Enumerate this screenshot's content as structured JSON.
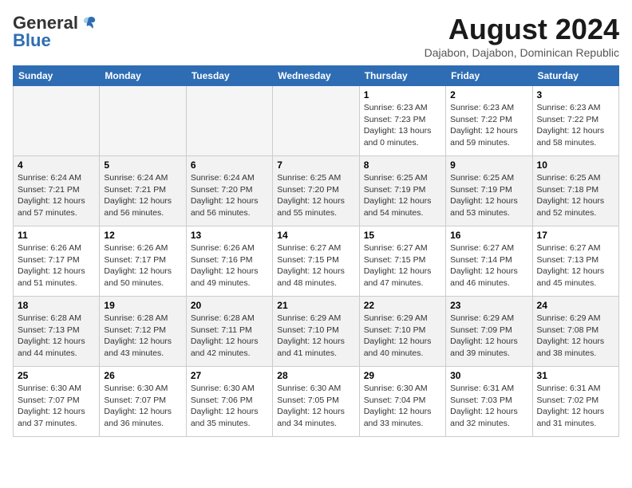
{
  "header": {
    "logo_general": "General",
    "logo_blue": "Blue",
    "month_title": "August 2024",
    "location": "Dajabon, Dajabon, Dominican Republic"
  },
  "calendar": {
    "days_of_week": [
      "Sunday",
      "Monday",
      "Tuesday",
      "Wednesday",
      "Thursday",
      "Friday",
      "Saturday"
    ],
    "weeks": [
      [
        {
          "day": "",
          "info": ""
        },
        {
          "day": "",
          "info": ""
        },
        {
          "day": "",
          "info": ""
        },
        {
          "day": "",
          "info": ""
        },
        {
          "day": "1",
          "info": "Sunrise: 6:23 AM\nSunset: 7:23 PM\nDaylight: 13 hours\nand 0 minutes."
        },
        {
          "day": "2",
          "info": "Sunrise: 6:23 AM\nSunset: 7:22 PM\nDaylight: 12 hours\nand 59 minutes."
        },
        {
          "day": "3",
          "info": "Sunrise: 6:23 AM\nSunset: 7:22 PM\nDaylight: 12 hours\nand 58 minutes."
        }
      ],
      [
        {
          "day": "4",
          "info": "Sunrise: 6:24 AM\nSunset: 7:21 PM\nDaylight: 12 hours\nand 57 minutes."
        },
        {
          "day": "5",
          "info": "Sunrise: 6:24 AM\nSunset: 7:21 PM\nDaylight: 12 hours\nand 56 minutes."
        },
        {
          "day": "6",
          "info": "Sunrise: 6:24 AM\nSunset: 7:20 PM\nDaylight: 12 hours\nand 56 minutes."
        },
        {
          "day": "7",
          "info": "Sunrise: 6:25 AM\nSunset: 7:20 PM\nDaylight: 12 hours\nand 55 minutes."
        },
        {
          "day": "8",
          "info": "Sunrise: 6:25 AM\nSunset: 7:19 PM\nDaylight: 12 hours\nand 54 minutes."
        },
        {
          "day": "9",
          "info": "Sunrise: 6:25 AM\nSunset: 7:19 PM\nDaylight: 12 hours\nand 53 minutes."
        },
        {
          "day": "10",
          "info": "Sunrise: 6:25 AM\nSunset: 7:18 PM\nDaylight: 12 hours\nand 52 minutes."
        }
      ],
      [
        {
          "day": "11",
          "info": "Sunrise: 6:26 AM\nSunset: 7:17 PM\nDaylight: 12 hours\nand 51 minutes."
        },
        {
          "day": "12",
          "info": "Sunrise: 6:26 AM\nSunset: 7:17 PM\nDaylight: 12 hours\nand 50 minutes."
        },
        {
          "day": "13",
          "info": "Sunrise: 6:26 AM\nSunset: 7:16 PM\nDaylight: 12 hours\nand 49 minutes."
        },
        {
          "day": "14",
          "info": "Sunrise: 6:27 AM\nSunset: 7:15 PM\nDaylight: 12 hours\nand 48 minutes."
        },
        {
          "day": "15",
          "info": "Sunrise: 6:27 AM\nSunset: 7:15 PM\nDaylight: 12 hours\nand 47 minutes."
        },
        {
          "day": "16",
          "info": "Sunrise: 6:27 AM\nSunset: 7:14 PM\nDaylight: 12 hours\nand 46 minutes."
        },
        {
          "day": "17",
          "info": "Sunrise: 6:27 AM\nSunset: 7:13 PM\nDaylight: 12 hours\nand 45 minutes."
        }
      ],
      [
        {
          "day": "18",
          "info": "Sunrise: 6:28 AM\nSunset: 7:13 PM\nDaylight: 12 hours\nand 44 minutes."
        },
        {
          "day": "19",
          "info": "Sunrise: 6:28 AM\nSunset: 7:12 PM\nDaylight: 12 hours\nand 43 minutes."
        },
        {
          "day": "20",
          "info": "Sunrise: 6:28 AM\nSunset: 7:11 PM\nDaylight: 12 hours\nand 42 minutes."
        },
        {
          "day": "21",
          "info": "Sunrise: 6:29 AM\nSunset: 7:10 PM\nDaylight: 12 hours\nand 41 minutes."
        },
        {
          "day": "22",
          "info": "Sunrise: 6:29 AM\nSunset: 7:10 PM\nDaylight: 12 hours\nand 40 minutes."
        },
        {
          "day": "23",
          "info": "Sunrise: 6:29 AM\nSunset: 7:09 PM\nDaylight: 12 hours\nand 39 minutes."
        },
        {
          "day": "24",
          "info": "Sunrise: 6:29 AM\nSunset: 7:08 PM\nDaylight: 12 hours\nand 38 minutes."
        }
      ],
      [
        {
          "day": "25",
          "info": "Sunrise: 6:30 AM\nSunset: 7:07 PM\nDaylight: 12 hours\nand 37 minutes."
        },
        {
          "day": "26",
          "info": "Sunrise: 6:30 AM\nSunset: 7:07 PM\nDaylight: 12 hours\nand 36 minutes."
        },
        {
          "day": "27",
          "info": "Sunrise: 6:30 AM\nSunset: 7:06 PM\nDaylight: 12 hours\nand 35 minutes."
        },
        {
          "day": "28",
          "info": "Sunrise: 6:30 AM\nSunset: 7:05 PM\nDaylight: 12 hours\nand 34 minutes."
        },
        {
          "day": "29",
          "info": "Sunrise: 6:30 AM\nSunset: 7:04 PM\nDaylight: 12 hours\nand 33 minutes."
        },
        {
          "day": "30",
          "info": "Sunrise: 6:31 AM\nSunset: 7:03 PM\nDaylight: 12 hours\nand 32 minutes."
        },
        {
          "day": "31",
          "info": "Sunrise: 6:31 AM\nSunset: 7:02 PM\nDaylight: 12 hours\nand 31 minutes."
        }
      ]
    ]
  }
}
